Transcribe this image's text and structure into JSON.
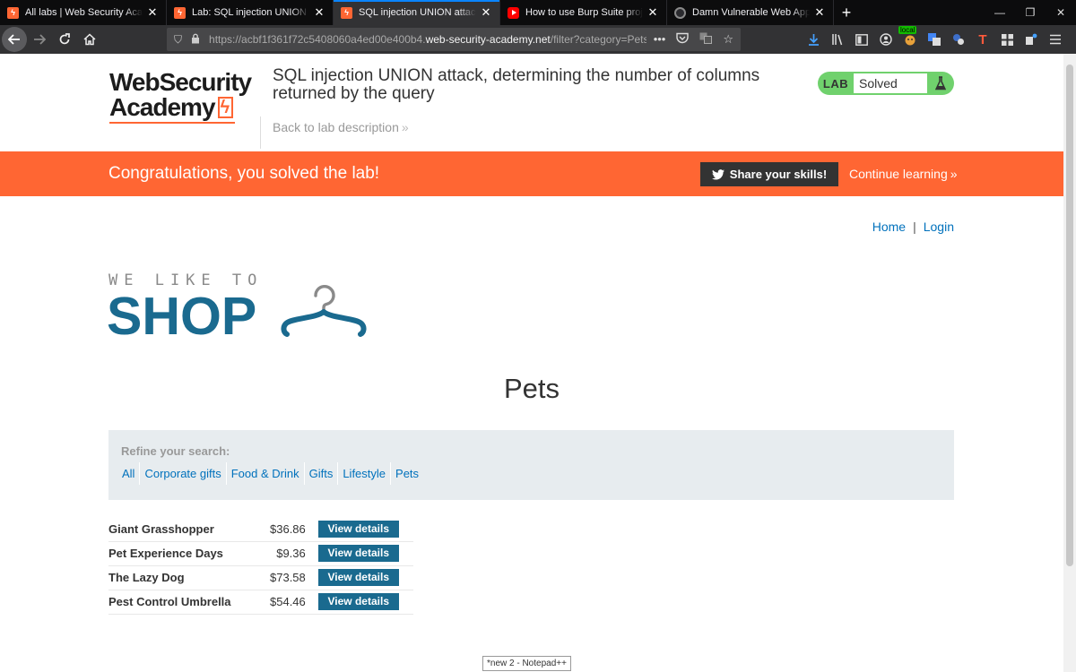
{
  "browser": {
    "tabs": [
      {
        "title": "All labs | Web Security Academy",
        "favicon": "wsa",
        "active": false
      },
      {
        "title": "Lab: SQL injection UNION attack, determining",
        "favicon": "wsa",
        "active": false
      },
      {
        "title": "SQL injection UNION attack, determining",
        "favicon": "wsa",
        "active": true
      },
      {
        "title": "How to use Burp Suite projects",
        "favicon": "youtube",
        "active": false
      },
      {
        "title": "Damn Vulnerable Web App (DVWA)",
        "favicon": "dvwa",
        "active": false
      }
    ],
    "url": {
      "prefix": "https://acbf1f361f72c5408060a4ed00e400b4.",
      "host": "web-security-academy.net",
      "path": "/filter?category=Pets"
    },
    "local_badge": "local",
    "ext_letter": "T",
    "accent_color": "#0a84ff"
  },
  "academy": {
    "logo_line1": "WebSecurity",
    "logo_line2": "Academy",
    "lab_title": "SQL injection UNION attack, determining the number of columns returned by the query",
    "back_link": "Back to lab description",
    "lab_label": "LAB",
    "status": "Solved",
    "status_color": "#70d16d"
  },
  "banner": {
    "message": "Congratulations, you solved the lab!",
    "share_label": "Share your skills!",
    "continue_label": "Continue learning",
    "color": "#ff6633"
  },
  "nav": {
    "home": "Home",
    "separator": "|",
    "login": "Login"
  },
  "shop": {
    "tagline": "WE LIKE TO",
    "name": "SHOP",
    "brand_color": "#1a6a8f"
  },
  "category": "Pets",
  "refine": {
    "label": "Refine your search:",
    "filters": [
      "All",
      "Corporate gifts",
      "Food & Drink",
      "Gifts",
      "Lifestyle",
      "Pets"
    ]
  },
  "products": [
    {
      "name": "Giant Grasshopper",
      "price": "$36.86",
      "action": "View details"
    },
    {
      "name": "Pet Experience Days",
      "price": "$9.36",
      "action": "View details"
    },
    {
      "name": "The Lazy Dog",
      "price": "$73.58",
      "action": "View details"
    },
    {
      "name": "Pest Control Umbrella",
      "price": "$54.46",
      "action": "View details"
    }
  ],
  "taskbar_tooltip": "*new 2 - Notepad++"
}
